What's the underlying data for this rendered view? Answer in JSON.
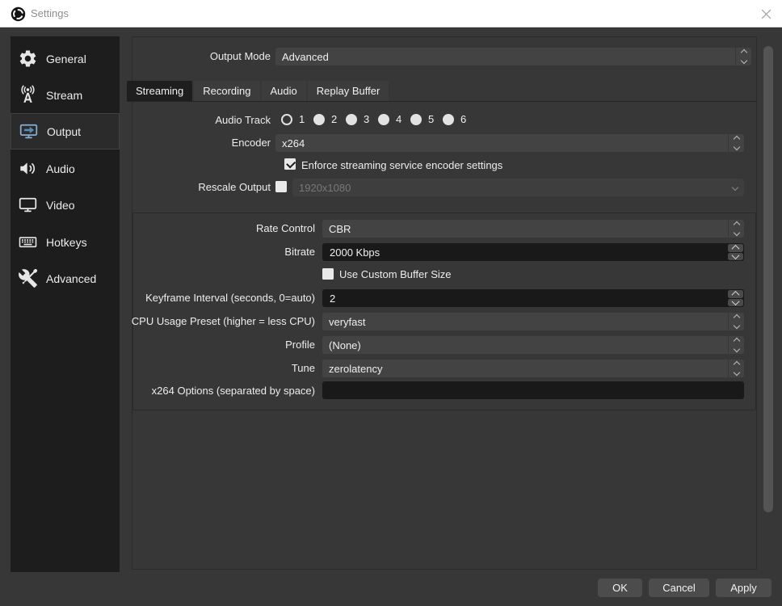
{
  "window": {
    "title": "Settings"
  },
  "colors": {
    "titlebar_bg": "#ffffff",
    "window_bg": "#373737",
    "sidebar_bg": "#1d1d1d",
    "sidebar_selected_bg": "#2b2b2b",
    "accent_icon_blue": "#7ba7cc",
    "combo_bg": "#434343",
    "input_dark_bg": "#191919",
    "tab_selected_bg": "#1e1e1e",
    "tab_bg": "#3c3c3c",
    "button_bg": "#4c4c4c"
  },
  "sidebar": {
    "items": [
      {
        "label": "General",
        "icon": "gear-icon",
        "selected": false
      },
      {
        "label": "Stream",
        "icon": "broadcast-icon",
        "selected": false
      },
      {
        "label": "Output",
        "icon": "output-icon",
        "selected": true
      },
      {
        "label": "Audio",
        "icon": "speaker-icon",
        "selected": false
      },
      {
        "label": "Video",
        "icon": "monitor-icon",
        "selected": false
      },
      {
        "label": "Hotkeys",
        "icon": "keyboard-icon",
        "selected": false
      },
      {
        "label": "Advanced",
        "icon": "tools-icon",
        "selected": false
      }
    ]
  },
  "output_mode": {
    "label": "Output Mode",
    "value": "Advanced"
  },
  "tabs": [
    {
      "label": "Streaming",
      "selected": true
    },
    {
      "label": "Recording",
      "selected": false
    },
    {
      "label": "Audio",
      "selected": false
    },
    {
      "label": "Replay Buffer",
      "selected": false
    }
  ],
  "form": {
    "audio_track": {
      "label": "Audio Track",
      "options": [
        {
          "label": "1",
          "selected": true
        },
        {
          "label": "2",
          "selected": false
        },
        {
          "label": "3",
          "selected": false
        },
        {
          "label": "4",
          "selected": false
        },
        {
          "label": "5",
          "selected": false
        },
        {
          "label": "6",
          "selected": false
        }
      ]
    },
    "encoder": {
      "label": "Encoder",
      "value": "x264"
    },
    "enforce": {
      "label": "Enforce streaming service encoder settings",
      "checked": true
    },
    "rescale": {
      "label": "Rescale Output",
      "checked": false,
      "value": "1920x1080",
      "disabled": true
    },
    "group": {
      "rate_control": {
        "label": "Rate Control",
        "value": "CBR"
      },
      "bitrate": {
        "label": "Bitrate",
        "value": "2000 Kbps"
      },
      "custom_buffer": {
        "label": "Use Custom Buffer Size",
        "checked": false
      },
      "keyframe_interval": {
        "label": "Keyframe Interval (seconds, 0=auto)",
        "value": "2"
      },
      "cpu_preset": {
        "label": "CPU Usage Preset (higher = less CPU)",
        "value": "veryfast"
      },
      "profile": {
        "label": "Profile",
        "value": "(None)"
      },
      "tune": {
        "label": "Tune",
        "value": "zerolatency"
      },
      "x264_options": {
        "label": "x264 Options (separated by space)",
        "value": ""
      }
    }
  },
  "footer": {
    "ok_label": "OK",
    "cancel_label": "Cancel",
    "apply_label": "Apply"
  }
}
